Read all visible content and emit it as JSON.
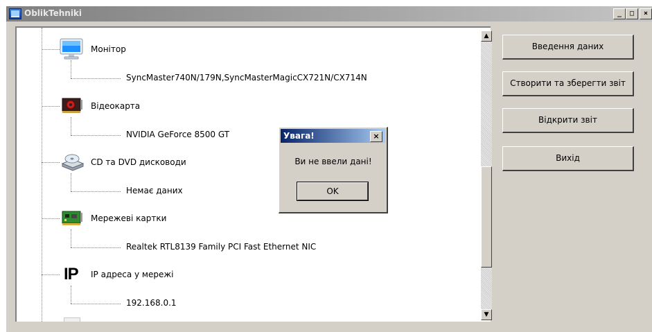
{
  "window": {
    "title": "OblikTehniki"
  },
  "title_buttons": {
    "minimize": "_",
    "maximize": "□",
    "close": "×"
  },
  "tree": {
    "nodes": [
      {
        "label": "Монітор",
        "icon": "monitor-icon",
        "child": "SyncMaster740N/179N,SyncMasterMagicCX721N/CX714N"
      },
      {
        "label": "Відеокарта",
        "icon": "video-card-icon",
        "child": "NVIDIA GeForce 8500 GT"
      },
      {
        "label": "CD та DVD дисководи",
        "icon": "optical-drive-icon",
        "child": "Немає даних"
      },
      {
        "label": "Мережеві картки",
        "icon": "network-card-icon",
        "child": "Realtek RTL8139 Family PCI Fast Ethernet NIC"
      },
      {
        "label": "IP адреса у мережі",
        "icon": "ip-icon",
        "child": "192.168.0.1"
      }
    ]
  },
  "ip_icon_text": "IP",
  "scroll": {
    "up": "▲",
    "down": "▼"
  },
  "buttons": {
    "enter_data": "Введення даних",
    "create_save_report": "Створити та зберегти звіт",
    "open_report": "Відкрити звіт",
    "exit": "Вихід"
  },
  "dialog": {
    "title": "Увага!",
    "close": "×",
    "message": "Ви не ввели дані!",
    "ok": "OK"
  }
}
